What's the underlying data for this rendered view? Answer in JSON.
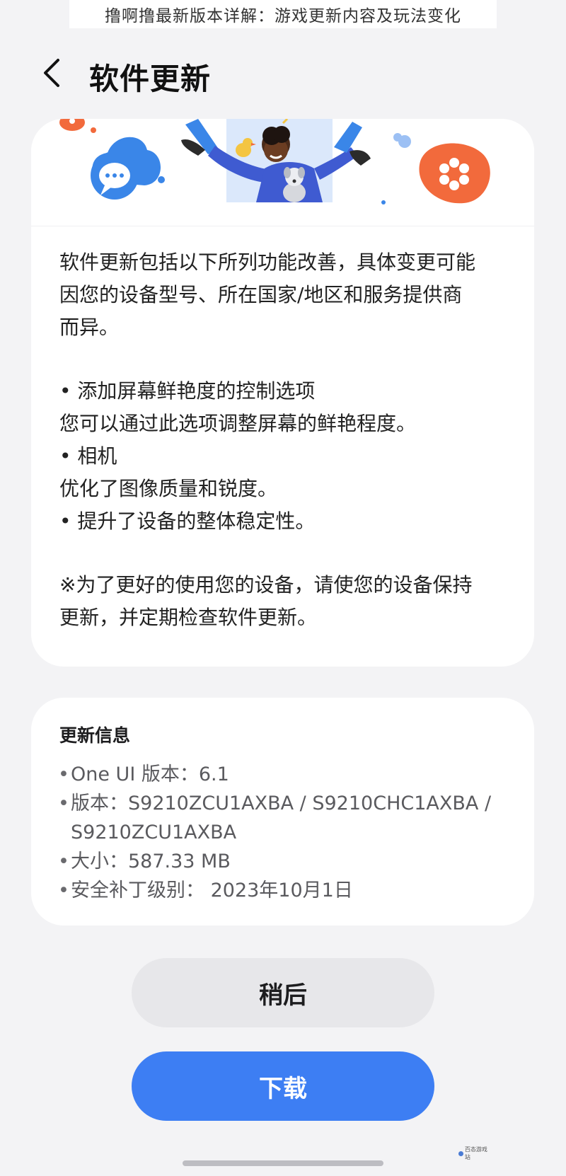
{
  "caption": "撸啊撸最新版本详解：游戏更新内容及玩法变化",
  "header": {
    "back_icon": "chevron-left-icon",
    "title": "软件更新"
  },
  "hero": {
    "icons": [
      "chat-bubble-icon",
      "flower-icon",
      "person-illustration",
      "bird-icon",
      "dog-icon"
    ],
    "colors": {
      "blue": "#3a86e8",
      "orange": "#f26a3c",
      "navy": "#2b3f7a"
    }
  },
  "notes": {
    "intro_lines": [
      "软件更新包括以下所列功能改善，具体变更可能",
      "因您的设备型号、所在国家/地区和服务提供商",
      "而异。"
    ],
    "items": [
      "• 添加屏幕鲜艳度的控制选项",
      "您可以通过此选项调整屏幕的鲜艳程度。",
      "• 相机",
      "优化了图像质量和锐度。",
      "• 提升了设备的整体稳定性。"
    ],
    "footer_lines": [
      "※为了更好的使用您的设备，请使您的设备保持",
      "更新，并定期检查软件更新。"
    ]
  },
  "info": {
    "title": "更新信息",
    "items": [
      "One UI 版本：6.1",
      "版本：S9210ZCU1AXBA / S9210CHC1AXBA /",
      "大小：587.33 MB",
      "安全补丁级别： 2023年10月1日"
    ],
    "version_continuation": "S9210ZCU1AXBA"
  },
  "buttons": {
    "later": "稍后",
    "download": "下载"
  },
  "watermark": "百态游戏站",
  "colors": {
    "background": "#f3f3f5",
    "primary": "#3d7ef3",
    "secondary_button": "#e7e7ea"
  }
}
